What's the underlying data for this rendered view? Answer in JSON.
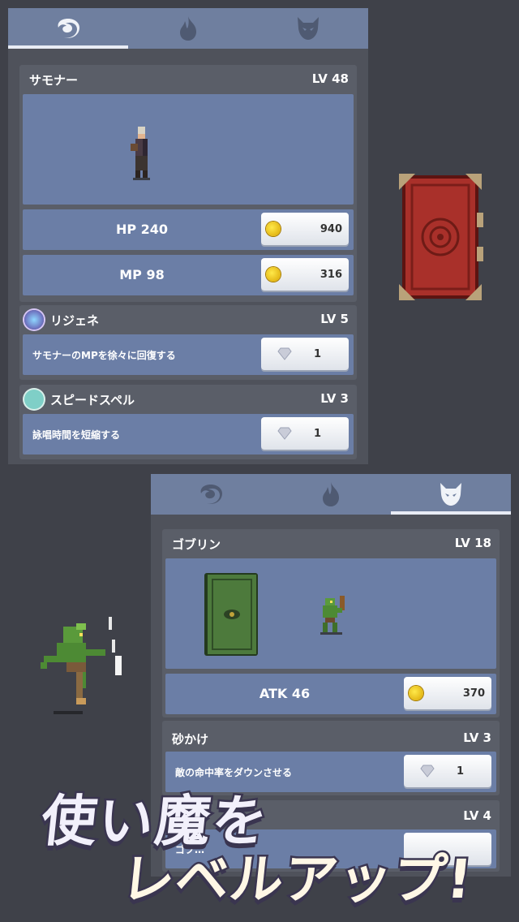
{
  "top_panel": {
    "tabs": [
      {
        "icon": "summoner-swirl-icon",
        "active": true
      },
      {
        "icon": "fire-icon",
        "active": false
      },
      {
        "icon": "demon-mask-icon",
        "active": false
      }
    ],
    "summoner": {
      "name": "サモナー",
      "level": "LV 48",
      "hp_label": "HP 240",
      "hp_cost": "940",
      "mp_label": "MP 98",
      "mp_cost": "316"
    },
    "skills": [
      {
        "name": "リジェネ",
        "level": "LV 5",
        "desc": "サモナーのMPを徐々に回復する",
        "cost": "1",
        "icon": "regen-icon"
      },
      {
        "name": "スピードスペル",
        "level": "LV 3",
        "desc": "詠唱時間を短縮する",
        "cost": "1",
        "icon": "hourglass-icon"
      }
    ]
  },
  "bottom_panel": {
    "tabs": [
      {
        "icon": "summoner-swirl-icon",
        "active": false
      },
      {
        "icon": "fire-icon",
        "active": false
      },
      {
        "icon": "demon-mask-icon",
        "active": true
      }
    ],
    "familiar": {
      "name": "ゴブリン",
      "level": "LV 18",
      "atk_label": "ATK 46",
      "atk_cost": "370"
    },
    "skills": [
      {
        "name": "砂かけ",
        "level": "LV 3",
        "desc": "敵の命中率をダウンさせる",
        "cost": "1"
      },
      {
        "name": "",
        "level": "LV 4",
        "desc": "ゴブ…",
        "cost": ""
      }
    ]
  },
  "promo": {
    "line1": "使い魔を",
    "line2": "レベルアップ!"
  },
  "colors": {
    "tab_bar": "#6f7f9f",
    "panel": "#4f525b",
    "row": "#6b7ea6",
    "background": "#3f4149"
  }
}
